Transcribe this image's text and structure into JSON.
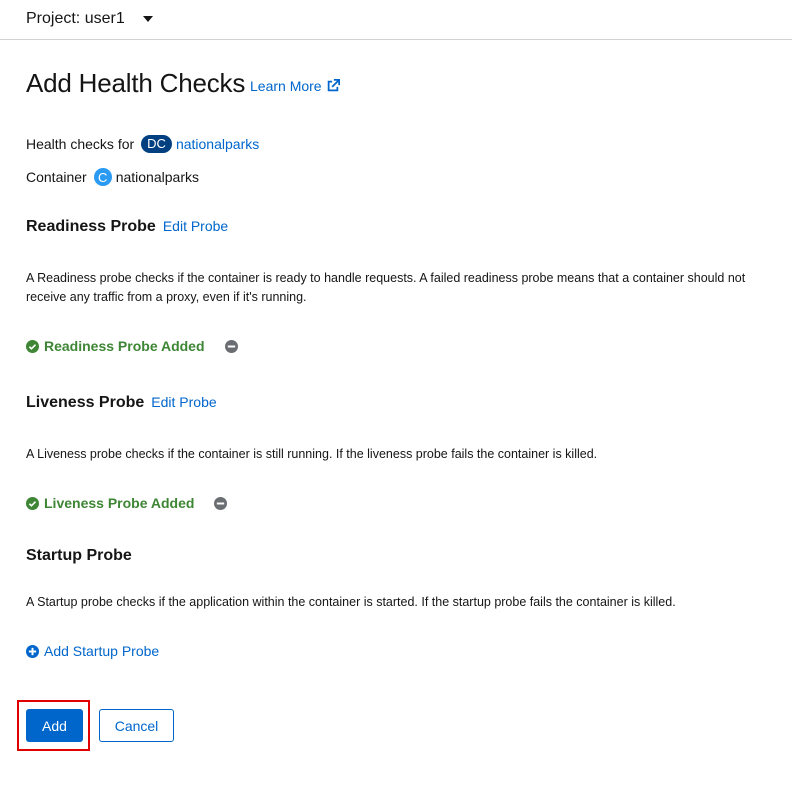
{
  "header": {
    "project_label": "Project: user1"
  },
  "page": {
    "title": "Add Health Checks",
    "learn_more": "Learn More"
  },
  "resource": {
    "health_checks_for_label": "Health checks for",
    "resource_badge": "DC",
    "resource_name": "nationalparks",
    "container_label": "Container",
    "container_badge": "C",
    "container_name": "nationalparks"
  },
  "readiness": {
    "title": "Readiness Probe",
    "edit_label": "Edit Probe",
    "description": "A Readiness probe checks if the container is ready to handle requests. A failed readiness probe means that a container should not receive any traffic from a proxy, even if it's running.",
    "status": "Readiness Probe Added"
  },
  "liveness": {
    "title": "Liveness Probe",
    "edit_label": "Edit Probe",
    "description": "A Liveness probe checks if the container is still running. If the liveness probe fails the container is killed.",
    "status": "Liveness Probe Added"
  },
  "startup": {
    "title": "Startup Probe",
    "description": "A Startup probe checks if the application within the container is started. If the startup probe fails the container is killed.",
    "add_label": "Add Startup Probe"
  },
  "actions": {
    "add_label": "Add",
    "cancel_label": "Cancel"
  },
  "colors": {
    "link": "#0066cc",
    "success": "#3e8635",
    "primary": "#0066cc",
    "dc_badge": "#004080",
    "container_badge": "#2b9af3",
    "highlight": "#e00000"
  },
  "icons": {
    "dropdown": "caret-down-icon",
    "external_link": "external-link-icon",
    "status": "check-circle-icon",
    "remove": "minus-circle-icon",
    "add": "plus-circle-icon"
  }
}
